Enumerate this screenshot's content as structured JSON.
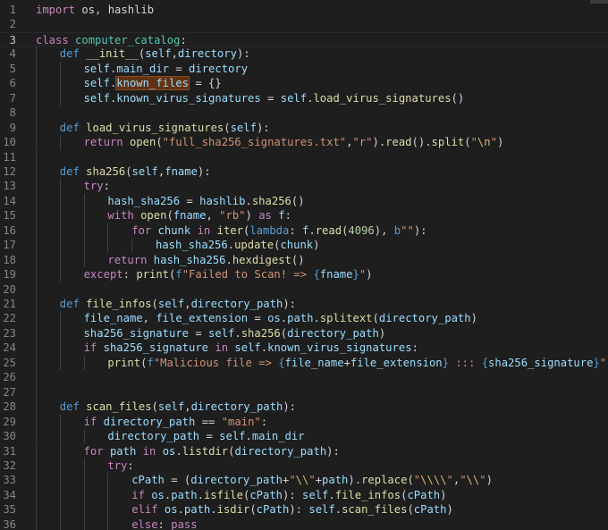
{
  "editor": {
    "current_line": 3,
    "lines": [
      {
        "n": "1",
        "indent": 0,
        "tokens": [
          [
            "kw",
            "import"
          ],
          [
            "p",
            " os, hashlib"
          ]
        ]
      },
      {
        "n": "2",
        "indent": 0,
        "tokens": []
      },
      {
        "n": "3",
        "indent": 0,
        "tokens": [
          [
            "kw",
            "class"
          ],
          [
            "p",
            " "
          ],
          [
            "cls",
            "computer_catalog"
          ],
          [
            "p",
            ":"
          ]
        ]
      },
      {
        "n": "4",
        "indent": 1,
        "tokens": [
          [
            "def",
            "def"
          ],
          [
            "p",
            " "
          ],
          [
            "fn",
            "__init__"
          ],
          [
            "p",
            "("
          ],
          [
            "var",
            "self"
          ],
          [
            "p",
            ","
          ],
          [
            "var",
            "directory"
          ],
          [
            "p",
            "):"
          ]
        ]
      },
      {
        "n": "5",
        "indent": 2,
        "tokens": [
          [
            "var",
            "self"
          ],
          [
            "p",
            "."
          ],
          [
            "var",
            "main_dir"
          ],
          [
            "p",
            " = "
          ],
          [
            "var",
            "directory"
          ]
        ]
      },
      {
        "n": "6",
        "indent": 2,
        "tokens": [
          [
            "var",
            "self"
          ],
          [
            "p",
            "."
          ],
          [
            "hl",
            "known_files"
          ],
          [
            "p",
            " = {}"
          ]
        ]
      },
      {
        "n": "7",
        "indent": 2,
        "tokens": [
          [
            "var",
            "self"
          ],
          [
            "p",
            "."
          ],
          [
            "var",
            "known_virus_signatures"
          ],
          [
            "p",
            " = "
          ],
          [
            "var",
            "self"
          ],
          [
            "p",
            "."
          ],
          [
            "fn",
            "load_virus_signatures"
          ],
          [
            "p",
            "()"
          ]
        ]
      },
      {
        "n": "8",
        "indent": 1,
        "tokens": []
      },
      {
        "n": "9",
        "indent": 1,
        "tokens": [
          [
            "def",
            "def"
          ],
          [
            "p",
            " "
          ],
          [
            "fn",
            "load_virus_signatures"
          ],
          [
            "p",
            "("
          ],
          [
            "var",
            "self"
          ],
          [
            "p",
            "):"
          ]
        ]
      },
      {
        "n": "10",
        "indent": 2,
        "tokens": [
          [
            "kw",
            "return"
          ],
          [
            "p",
            " "
          ],
          [
            "fn",
            "open"
          ],
          [
            "p",
            "("
          ],
          [
            "str",
            "\"full_sha256_signatures.txt\""
          ],
          [
            "p",
            ","
          ],
          [
            "str",
            "\"r\""
          ],
          [
            "p",
            ")."
          ],
          [
            "fn",
            "read"
          ],
          [
            "p",
            "()."
          ],
          [
            "fn",
            "split"
          ],
          [
            "p",
            "("
          ],
          [
            "str",
            "\""
          ],
          [
            "esc",
            "\\n"
          ],
          [
            "str",
            "\""
          ],
          [
            "p",
            ")"
          ]
        ]
      },
      {
        "n": "11",
        "indent": 1,
        "tokens": []
      },
      {
        "n": "12",
        "indent": 1,
        "tokens": [
          [
            "def",
            "def"
          ],
          [
            "p",
            " "
          ],
          [
            "fn",
            "sha256"
          ],
          [
            "p",
            "("
          ],
          [
            "var",
            "self"
          ],
          [
            "p",
            ","
          ],
          [
            "var",
            "fname"
          ],
          [
            "p",
            "):"
          ]
        ]
      },
      {
        "n": "13",
        "indent": 2,
        "tokens": [
          [
            "kw",
            "try"
          ],
          [
            "p",
            ":"
          ]
        ]
      },
      {
        "n": "14",
        "indent": 3,
        "tokens": [
          [
            "var",
            "hash_sha256"
          ],
          [
            "p",
            " = "
          ],
          [
            "var",
            "hashlib"
          ],
          [
            "p",
            "."
          ],
          [
            "fn",
            "sha256"
          ],
          [
            "p",
            "()"
          ]
        ]
      },
      {
        "n": "15",
        "indent": 3,
        "tokens": [
          [
            "kw",
            "with"
          ],
          [
            "p",
            " "
          ],
          [
            "fn",
            "open"
          ],
          [
            "p",
            "("
          ],
          [
            "var",
            "fname"
          ],
          [
            "p",
            ", "
          ],
          [
            "str",
            "\"rb\""
          ],
          [
            "p",
            ") "
          ],
          [
            "kw",
            "as"
          ],
          [
            "p",
            " "
          ],
          [
            "var",
            "f"
          ],
          [
            "p",
            ":"
          ]
        ]
      },
      {
        "n": "16",
        "indent": 4,
        "tokens": [
          [
            "kw",
            "for"
          ],
          [
            "p",
            " "
          ],
          [
            "var",
            "chunk"
          ],
          [
            "p",
            " "
          ],
          [
            "kw",
            "in"
          ],
          [
            "p",
            " "
          ],
          [
            "fn",
            "iter"
          ],
          [
            "p",
            "("
          ],
          [
            "def",
            "lambda"
          ],
          [
            "p",
            ": "
          ],
          [
            "var",
            "f"
          ],
          [
            "p",
            "."
          ],
          [
            "fn",
            "read"
          ],
          [
            "p",
            "("
          ],
          [
            "num",
            "4096"
          ],
          [
            "p",
            "), "
          ],
          [
            "def",
            "b"
          ],
          [
            "str",
            "\"\""
          ],
          [
            "p",
            "):"
          ]
        ]
      },
      {
        "n": "17",
        "indent": 5,
        "tokens": [
          [
            "var",
            "hash_sha256"
          ],
          [
            "p",
            "."
          ],
          [
            "fn",
            "update"
          ],
          [
            "p",
            "("
          ],
          [
            "var",
            "chunk"
          ],
          [
            "p",
            ")"
          ]
        ]
      },
      {
        "n": "18",
        "indent": 3,
        "tokens": [
          [
            "kw",
            "return"
          ],
          [
            "p",
            " "
          ],
          [
            "var",
            "hash_sha256"
          ],
          [
            "p",
            "."
          ],
          [
            "fn",
            "hexdigest"
          ],
          [
            "p",
            "()"
          ]
        ]
      },
      {
        "n": "19",
        "indent": 2,
        "tokens": [
          [
            "kw",
            "except"
          ],
          [
            "p",
            ": "
          ],
          [
            "fn",
            "print"
          ],
          [
            "p",
            "("
          ],
          [
            "def",
            "f"
          ],
          [
            "str",
            "\"Failed to Scan! => "
          ],
          [
            "def",
            "{"
          ],
          [
            "var",
            "fname"
          ],
          [
            "def",
            "}"
          ],
          [
            "str",
            "\""
          ],
          [
            "p",
            ")"
          ]
        ]
      },
      {
        "n": "20",
        "indent": 1,
        "tokens": []
      },
      {
        "n": "21",
        "indent": 1,
        "tokens": [
          [
            "def",
            "def"
          ],
          [
            "p",
            " "
          ],
          [
            "fn",
            "file_infos"
          ],
          [
            "p",
            "("
          ],
          [
            "var",
            "self"
          ],
          [
            "p",
            ","
          ],
          [
            "var",
            "directory_path"
          ],
          [
            "p",
            "):"
          ]
        ]
      },
      {
        "n": "22",
        "indent": 2,
        "tokens": [
          [
            "var",
            "file_name"
          ],
          [
            "p",
            ", "
          ],
          [
            "var",
            "file_extension"
          ],
          [
            "p",
            " = "
          ],
          [
            "var",
            "os"
          ],
          [
            "p",
            "."
          ],
          [
            "var",
            "path"
          ],
          [
            "p",
            "."
          ],
          [
            "fn",
            "splitext"
          ],
          [
            "p",
            "("
          ],
          [
            "var",
            "directory_path"
          ],
          [
            "p",
            ")"
          ]
        ]
      },
      {
        "n": "23",
        "indent": 2,
        "tokens": [
          [
            "var",
            "sha256_signature"
          ],
          [
            "p",
            " = "
          ],
          [
            "var",
            "self"
          ],
          [
            "p",
            "."
          ],
          [
            "fn",
            "sha256"
          ],
          [
            "p",
            "("
          ],
          [
            "var",
            "directory_path"
          ],
          [
            "p",
            ")"
          ]
        ]
      },
      {
        "n": "24",
        "indent": 2,
        "tokens": [
          [
            "kw",
            "if"
          ],
          [
            "p",
            " "
          ],
          [
            "var",
            "sha256_signature"
          ],
          [
            "p",
            " "
          ],
          [
            "kw",
            "in"
          ],
          [
            "p",
            " "
          ],
          [
            "var",
            "self"
          ],
          [
            "p",
            "."
          ],
          [
            "var",
            "known_virus_signatures"
          ],
          [
            "p",
            ":"
          ]
        ]
      },
      {
        "n": "25",
        "indent": 3,
        "tokens": [
          [
            "fn",
            "print"
          ],
          [
            "p",
            "("
          ],
          [
            "def",
            "f"
          ],
          [
            "str",
            "\"Malicious file => "
          ],
          [
            "def",
            "{"
          ],
          [
            "var",
            "file_name"
          ],
          [
            "p",
            "+"
          ],
          [
            "var",
            "file_extension"
          ],
          [
            "def",
            "}"
          ],
          [
            "str",
            " ::: "
          ],
          [
            "def",
            "{"
          ],
          [
            "var",
            "sha256_signature"
          ],
          [
            "def",
            "}"
          ],
          [
            "str",
            "\""
          ],
          [
            "p",
            ")"
          ]
        ]
      },
      {
        "n": "26",
        "indent": 1,
        "tokens": []
      },
      {
        "n": "27",
        "indent": 1,
        "tokens": []
      },
      {
        "n": "28",
        "indent": 1,
        "tokens": [
          [
            "def",
            "def"
          ],
          [
            "p",
            " "
          ],
          [
            "fn",
            "scan_files"
          ],
          [
            "p",
            "("
          ],
          [
            "var",
            "self"
          ],
          [
            "p",
            ","
          ],
          [
            "var",
            "directory_path"
          ],
          [
            "p",
            "):"
          ]
        ]
      },
      {
        "n": "29",
        "indent": 2,
        "tokens": [
          [
            "kw",
            "if"
          ],
          [
            "p",
            " "
          ],
          [
            "var",
            "directory_path"
          ],
          [
            "p",
            " == "
          ],
          [
            "str",
            "\"main\""
          ],
          [
            "p",
            ":"
          ]
        ]
      },
      {
        "n": "30",
        "indent": 3,
        "tokens": [
          [
            "var",
            "directory_path"
          ],
          [
            "p",
            " = "
          ],
          [
            "var",
            "self"
          ],
          [
            "p",
            "."
          ],
          [
            "var",
            "main_dir"
          ]
        ]
      },
      {
        "n": "31",
        "indent": 2,
        "tokens": [
          [
            "kw",
            "for"
          ],
          [
            "p",
            " "
          ],
          [
            "var",
            "path"
          ],
          [
            "p",
            " "
          ],
          [
            "kw",
            "in"
          ],
          [
            "p",
            " "
          ],
          [
            "var",
            "os"
          ],
          [
            "p",
            "."
          ],
          [
            "fn",
            "listdir"
          ],
          [
            "p",
            "("
          ],
          [
            "var",
            "directory_path"
          ],
          [
            "p",
            "):"
          ]
        ]
      },
      {
        "n": "32",
        "indent": 3,
        "tokens": [
          [
            "kw",
            "try"
          ],
          [
            "p",
            ":"
          ]
        ]
      },
      {
        "n": "33",
        "indent": 4,
        "tokens": [
          [
            "var",
            "cPath"
          ],
          [
            "p",
            " = ("
          ],
          [
            "var",
            "directory_path"
          ],
          [
            "p",
            "+"
          ],
          [
            "str",
            "\""
          ],
          [
            "esc",
            "\\\\"
          ],
          [
            "str",
            "\""
          ],
          [
            "p",
            "+"
          ],
          [
            "var",
            "path"
          ],
          [
            "p",
            ")."
          ],
          [
            "fn",
            "replace"
          ],
          [
            "p",
            "("
          ],
          [
            "str",
            "\""
          ],
          [
            "esc",
            "\\\\\\\\"
          ],
          [
            "str",
            "\""
          ],
          [
            "p",
            ","
          ],
          [
            "str",
            "\""
          ],
          [
            "esc",
            "\\\\"
          ],
          [
            "str",
            "\""
          ],
          [
            "p",
            ")"
          ]
        ]
      },
      {
        "n": "34",
        "indent": 4,
        "tokens": [
          [
            "kw",
            "if"
          ],
          [
            "p",
            " "
          ],
          [
            "var",
            "os"
          ],
          [
            "p",
            "."
          ],
          [
            "var",
            "path"
          ],
          [
            "p",
            "."
          ],
          [
            "fn",
            "isfile"
          ],
          [
            "p",
            "("
          ],
          [
            "var",
            "cPath"
          ],
          [
            "p",
            "): "
          ],
          [
            "var",
            "self"
          ],
          [
            "p",
            "."
          ],
          [
            "fn",
            "file_infos"
          ],
          [
            "p",
            "("
          ],
          [
            "var",
            "cPath"
          ],
          [
            "p",
            ")"
          ]
        ]
      },
      {
        "n": "35",
        "indent": 4,
        "tokens": [
          [
            "kw",
            "elif"
          ],
          [
            "p",
            " "
          ],
          [
            "var",
            "os"
          ],
          [
            "p",
            "."
          ],
          [
            "var",
            "path"
          ],
          [
            "p",
            "."
          ],
          [
            "fn",
            "isdir"
          ],
          [
            "p",
            "("
          ],
          [
            "var",
            "cPath"
          ],
          [
            "p",
            "): "
          ],
          [
            "var",
            "self"
          ],
          [
            "p",
            "."
          ],
          [
            "fn",
            "scan_files"
          ],
          [
            "p",
            "("
          ],
          [
            "var",
            "cPath"
          ],
          [
            "p",
            ")"
          ]
        ]
      },
      {
        "n": "36",
        "indent": 4,
        "tokens": [
          [
            "kw",
            "else"
          ],
          [
            "p",
            ": "
          ],
          [
            "kw",
            "pass"
          ]
        ]
      }
    ]
  },
  "colors": {
    "kw": "#c586c0",
    "def": "#569cd6",
    "fn": "#dcdcaa",
    "cls": "#4ec9b0",
    "var": "#9cdcfe",
    "str": "#ce9178",
    "esc": "#d7ba7d",
    "num": "#b5cea8",
    "p": "#d4d4d4",
    "hl": "#9cdcfe"
  }
}
